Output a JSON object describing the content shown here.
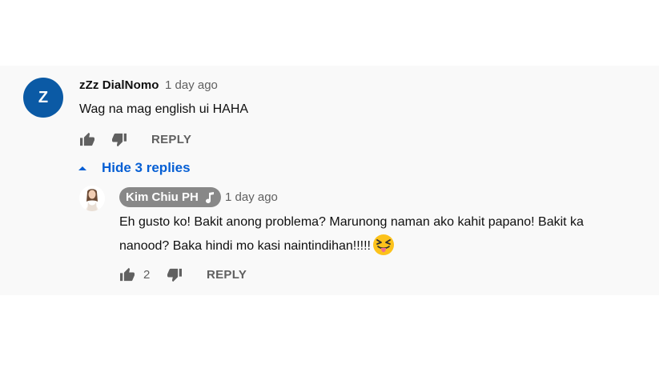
{
  "comment": {
    "avatar_letter": "Z",
    "author": "zZz DialNomo",
    "time": "1 day ago",
    "text": "Wag na mag english ui HAHA",
    "reply_label": "REPLY"
  },
  "replies_toggle": {
    "label": "Hide 3 replies"
  },
  "reply": {
    "author": "Kim Chiu PH",
    "time": "1 day ago",
    "text_line1": "Eh gusto ko! Bakit anong problema? Marunong naman ako kahit papano! Bakit ka",
    "text_line2": "nanood? Baka hindi mo kasi naintindihan!!!!!",
    "emoji": "squinting-face-with-tongue",
    "like_count": "2",
    "reply_label": "REPLY"
  },
  "colors": {
    "panel_bg": "#f9f9f9",
    "avatar_blue": "#0b5aa5",
    "link_blue": "#065fd4",
    "owner_chip": "#888888",
    "muted_text": "#606060"
  }
}
